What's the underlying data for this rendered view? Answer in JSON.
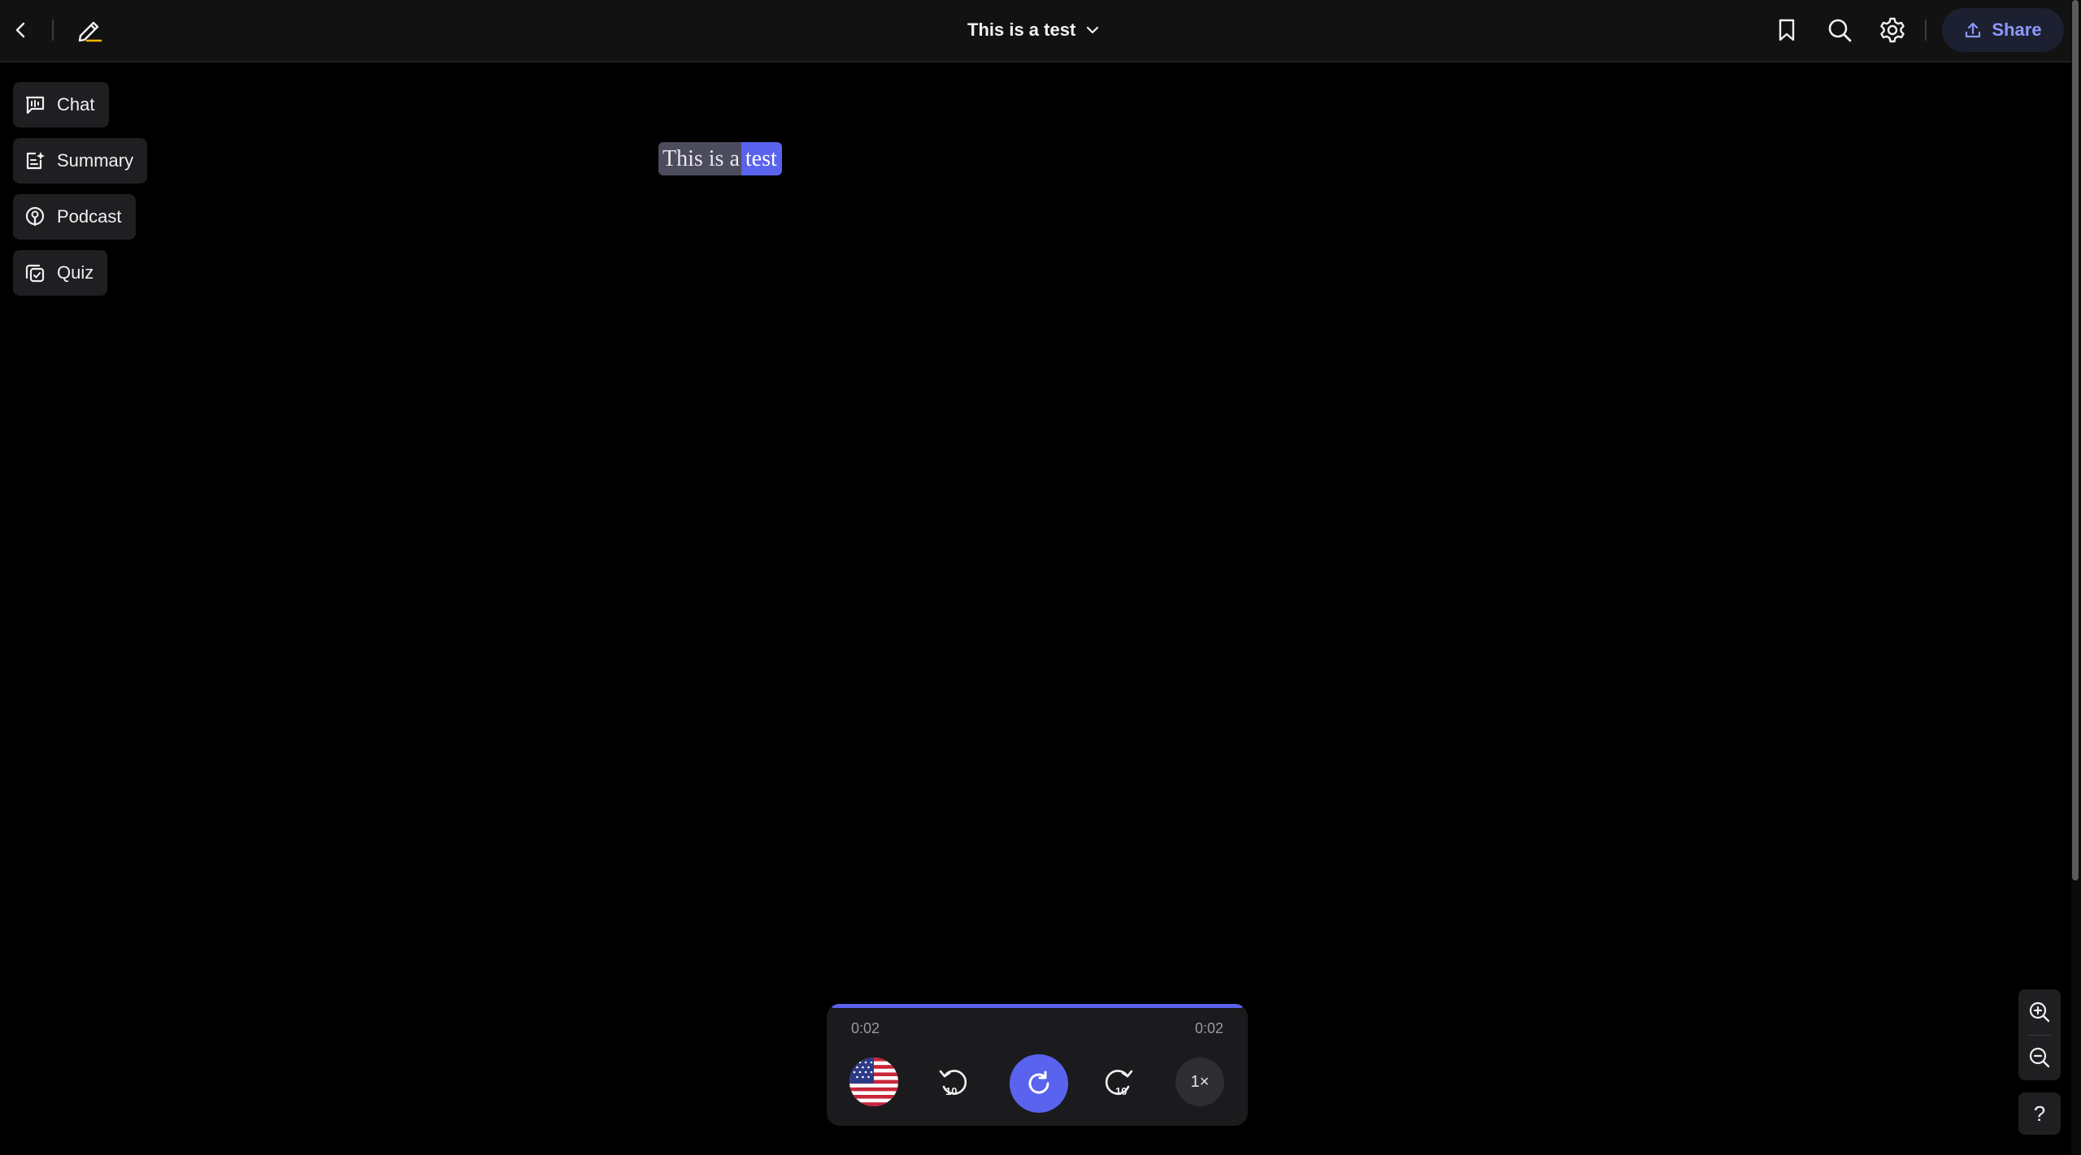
{
  "header": {
    "title": "This is a test",
    "share_label": "Share",
    "icons": [
      "back-icon",
      "pen-icon",
      "chevron-down-icon",
      "bookmark-icon",
      "search-icon",
      "gear-icon",
      "upload-icon"
    ]
  },
  "sidebar": {
    "items": [
      {
        "label": "Chat",
        "icon": "chat-icon"
      },
      {
        "label": "Summary",
        "icon": "summary-icon"
      },
      {
        "label": "Podcast",
        "icon": "podcast-icon"
      },
      {
        "label": "Quiz",
        "icon": "quiz-icon"
      }
    ]
  },
  "content": {
    "text_before_highlight": "This is a",
    "highlighted_word": "test"
  },
  "player": {
    "elapsed": "0:02",
    "duration": "0:02",
    "progress": 1.0,
    "speed": "1×",
    "voice_flag": "us-flag-icon",
    "rewind_icon": "rewind-10-icon",
    "forward_icon": "forward-10-icon",
    "play_icon": "replay-icon"
  },
  "zoom": {
    "in_icon": "zoom-in-icon",
    "out_icon": "zoom-out-icon"
  },
  "help_label": "?",
  "colors": {
    "accent": "#5a63ee",
    "share_text": "#8d98ff",
    "pen_tip": "#f5b400"
  }
}
